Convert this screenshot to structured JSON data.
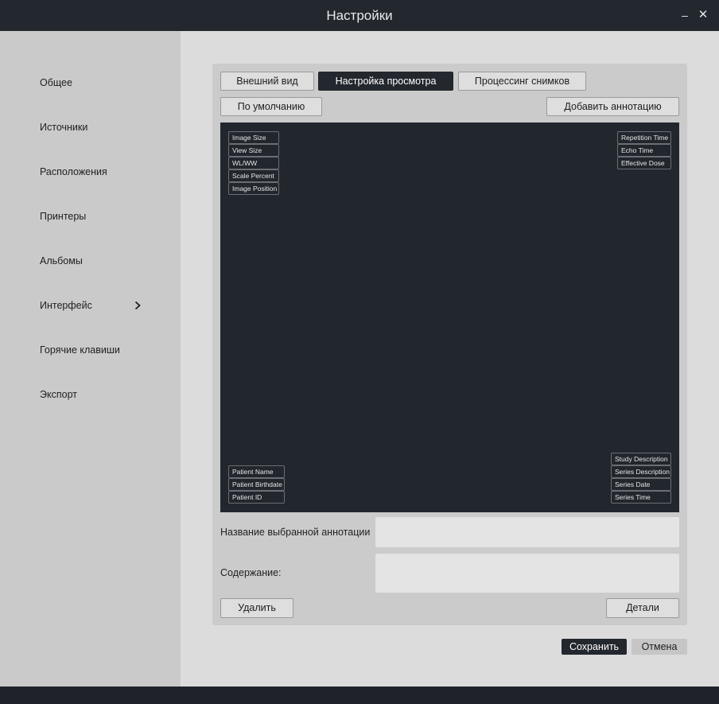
{
  "window": {
    "title": "Настройки",
    "minimize_glyph": "–",
    "close_glyph": "✕"
  },
  "sidebar": {
    "items": [
      {
        "label": "Общее"
      },
      {
        "label": "Источники"
      },
      {
        "label": "Расположения"
      },
      {
        "label": "Принтеры"
      },
      {
        "label": "Альбомы"
      },
      {
        "label": "Интерфейс",
        "expandable": true,
        "icon": "chevron-right-icon"
      },
      {
        "label": "Горячие клавиши"
      },
      {
        "label": "Экспорт"
      }
    ]
  },
  "tabs": [
    {
      "label": "Внешний вид",
      "active": false
    },
    {
      "label": "Настройка просмотра",
      "active": true
    },
    {
      "label": "Процессинг снимков",
      "active": false
    }
  ],
  "toolbar": {
    "default_label": "По умолчанию",
    "add_annotation_label": "Добавить аннотацию"
  },
  "annotations": {
    "top_left": [
      "Image Size",
      "View Size",
      "WL/WW",
      "Scale Percent",
      "Image Position"
    ],
    "top_right": [
      "Repetition Time",
      "Echo Time",
      "Effective Dose"
    ],
    "bottom_left": [
      "Patient Name",
      "Patient Birthdate",
      "Patient ID"
    ],
    "bottom_right": [
      "Study Description",
      "Series Description",
      "Series Date",
      "Series Time"
    ]
  },
  "form": {
    "name_label": "Название выбранной аннотации",
    "name_value": "",
    "content_label": "Содержание:",
    "content_value": ""
  },
  "actions": {
    "delete_label": "Удалить",
    "details_label": "Детали"
  },
  "footer": {
    "save_label": "Сохранить",
    "cancel_label": "Отмена"
  },
  "colors": {
    "accent": "#23272e",
    "sidebar_bg": "#cacaca",
    "main_bg": "#dcdcdc",
    "preview_bg": "#22262d"
  }
}
